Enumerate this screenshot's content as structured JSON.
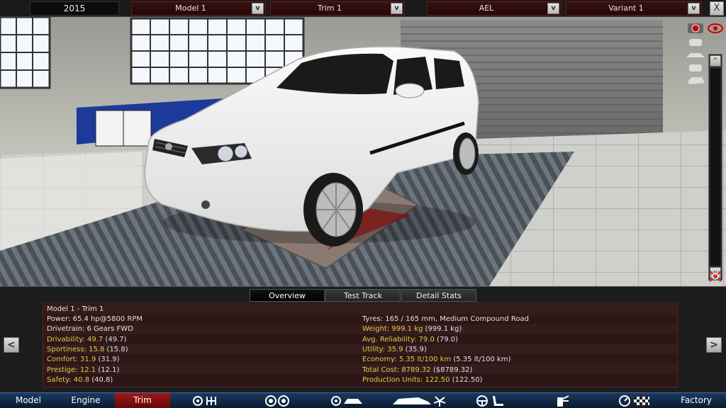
{
  "topbar": {
    "year": "2015",
    "model_dropdown": "Model 1",
    "trim_dropdown": "Trim 1",
    "engine_dropdown": "AEL",
    "variant_dropdown": "Variant 1",
    "dropdown_button": "v",
    "close_label": "X"
  },
  "viewport": {
    "scroll_up": "^",
    "scroll_down": "v"
  },
  "tabs": [
    "Overview",
    "Test Track",
    "Detail Stats"
  ],
  "nav_arrows": {
    "left": "<",
    "right": ">"
  },
  "stats": {
    "title": "Model 1 - Trim 1",
    "left": [
      {
        "label": "Power: 65.4 hp@5800 RPM",
        "paren": "",
        "highlight": false
      },
      {
        "label": "Drivetrain: 6 Gears FWD",
        "paren": "",
        "highlight": false
      },
      {
        "label": "Drivability: 49.7",
        "paren": " (49.7)",
        "highlight": true
      },
      {
        "label": "Sportiness: 15.8",
        "paren": " (15.8)",
        "highlight": true
      },
      {
        "label": "Comfort: 31.9",
        "paren": " (31.9)",
        "highlight": true
      },
      {
        "label": "Prestige: 12.1",
        "paren": " (12.1)",
        "highlight": true
      },
      {
        "label": "Safety: 40.8",
        "paren": " (40.8)",
        "highlight": true
      }
    ],
    "right": [
      {
        "label": "Tyres: 165 / 165 mm, Medium Compound Road",
        "paren": "",
        "highlight": false
      },
      {
        "label": "Weight: 999.1 kg",
        "paren": " (999.1 kg)",
        "highlight": true
      },
      {
        "label": "Avg. Reliability: 79.0",
        "paren": " (79.0)",
        "highlight": true
      },
      {
        "label": "Utility: 35.9",
        "paren": " (35.9)",
        "highlight": true
      },
      {
        "label": "Economy: 5.35 lt/100 km",
        "paren": " (5.35 lt/100 km)",
        "highlight": true
      },
      {
        "label": "Total Cost: 8789.32",
        "paren": " ($8789.32)",
        "highlight": true
      },
      {
        "label": "Production Units: 122.50",
        "paren": " (122.50)",
        "highlight": true
      }
    ]
  },
  "navbar": {
    "items": [
      "Model",
      "Engine",
      "Trim",
      "Factory"
    ],
    "active": "Trim"
  },
  "colors": {
    "accent_red": "#a01818",
    "stat_highlight": "#e8c84a",
    "nav_blue": "#1a3a60"
  }
}
